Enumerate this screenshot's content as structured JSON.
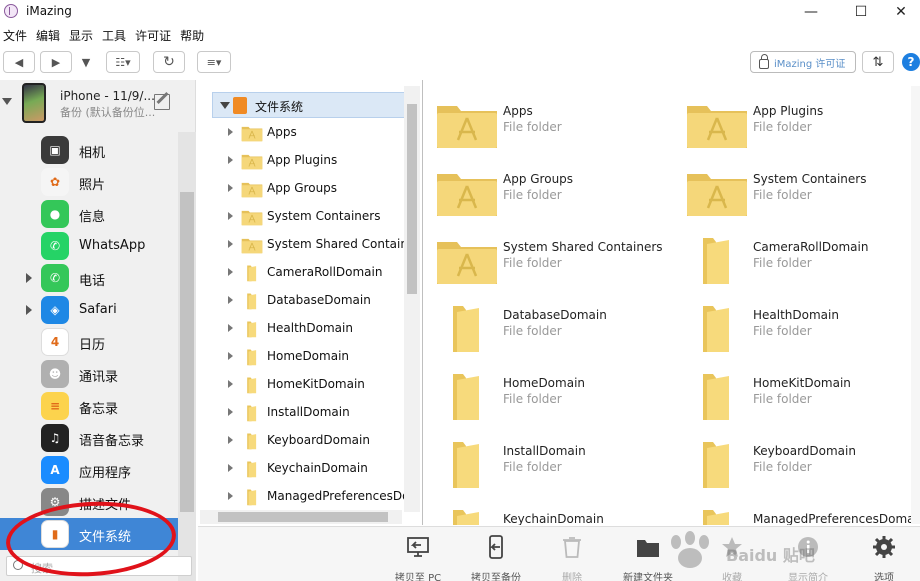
{
  "app": {
    "title": "iMazing"
  },
  "window_controls": {
    "minimize": "—",
    "maximize": "☐",
    "close": "✕"
  },
  "menu": [
    "文件",
    "编辑",
    "显示",
    "工具",
    "许可证",
    "帮助"
  ],
  "toolbar": {
    "back": "◀",
    "forward": "▶",
    "dropdown": "▼",
    "view": "☷▾",
    "refresh": "↻",
    "list": "≡▾",
    "license_label": "iMazing 许可证",
    "transfer": "⇅",
    "help": "?"
  },
  "device": {
    "name": "iPhone - 11/9/...",
    "subtitle": "备份 (默认备份位..."
  },
  "sidebar": {
    "items": [
      {
        "label": "相机",
        "icon": "camera-icon",
        "color": "#3a3a3a",
        "glyph": "▣",
        "expandable": false
      },
      {
        "label": "照片",
        "icon": "photos-icon",
        "color": "#f5f5f5",
        "glyph": "✿",
        "expandable": false
      },
      {
        "label": "信息",
        "icon": "messages-icon",
        "color": "#34c759",
        "glyph": "●",
        "expandable": false
      },
      {
        "label": "WhatsApp",
        "icon": "whatsapp-icon",
        "color": "#25d366",
        "glyph": "✆",
        "expandable": false
      },
      {
        "label": "电话",
        "icon": "phone-icon",
        "color": "#34c759",
        "glyph": "✆",
        "expandable": true
      },
      {
        "label": "Safari",
        "icon": "safari-icon",
        "color": "#1e88e5",
        "glyph": "◈",
        "expandable": true
      },
      {
        "label": "日历",
        "icon": "calendar-icon",
        "color": "#ffffff",
        "glyph": "4",
        "expandable": false
      },
      {
        "label": "通讯录",
        "icon": "contacts-icon",
        "color": "#b0b0b0",
        "glyph": "☻",
        "expandable": false
      },
      {
        "label": "备忘录",
        "icon": "notes-icon",
        "color": "#fcd34d",
        "glyph": "≡",
        "expandable": false
      },
      {
        "label": "语音备忘录",
        "icon": "voice-memos-icon",
        "color": "#222222",
        "glyph": "♫",
        "expandable": false
      },
      {
        "label": "应用程序",
        "icon": "app-store-icon",
        "color": "#1a8cff",
        "glyph": "A",
        "expandable": false
      },
      {
        "label": "描述文件",
        "icon": "profiles-icon",
        "color": "#888888",
        "glyph": "⚙",
        "expandable": false
      },
      {
        "label": "文件系统",
        "icon": "file-system-icon",
        "color": "#ffffff",
        "glyph": "▮",
        "expandable": false,
        "selected": true
      }
    ],
    "search_placeholder": "搜索"
  },
  "tree": {
    "root": "文件系统",
    "items": [
      {
        "label": "Apps",
        "kind": "app-folder"
      },
      {
        "label": "App Plugins",
        "kind": "app-folder"
      },
      {
        "label": "App Groups",
        "kind": "app-folder"
      },
      {
        "label": "System Containers",
        "kind": "app-folder"
      },
      {
        "label": "System Shared Containers",
        "kind": "app-folder"
      },
      {
        "label": "CameraRollDomain",
        "kind": "folder"
      },
      {
        "label": "DatabaseDomain",
        "kind": "folder"
      },
      {
        "label": "HealthDomain",
        "kind": "folder"
      },
      {
        "label": "HomeDomain",
        "kind": "folder"
      },
      {
        "label": "HomeKitDomain",
        "kind": "folder"
      },
      {
        "label": "InstallDomain",
        "kind": "folder"
      },
      {
        "label": "KeyboardDomain",
        "kind": "folder"
      },
      {
        "label": "KeychainDomain",
        "kind": "folder"
      },
      {
        "label": "ManagedPreferencesDom",
        "kind": "folder"
      }
    ]
  },
  "pane": {
    "type_label": "File folder",
    "items": [
      {
        "name": "Apps",
        "kind": "app-folder"
      },
      {
        "name": "App Plugins",
        "kind": "app-folder"
      },
      {
        "name": "App Groups",
        "kind": "app-folder"
      },
      {
        "name": "System Containers",
        "kind": "app-folder"
      },
      {
        "name": "System Shared Containers",
        "kind": "app-folder"
      },
      {
        "name": "CameraRollDomain",
        "kind": "folder"
      },
      {
        "name": "DatabaseDomain",
        "kind": "folder"
      },
      {
        "name": "HealthDomain",
        "kind": "folder"
      },
      {
        "name": "HomeDomain",
        "kind": "folder"
      },
      {
        "name": "HomeKitDomain",
        "kind": "folder"
      },
      {
        "name": "InstallDomain",
        "kind": "folder"
      },
      {
        "name": "KeyboardDomain",
        "kind": "folder"
      },
      {
        "name": "KeychainDomain",
        "kind": "folder"
      },
      {
        "name": "ManagedPreferencesDomain",
        "kind": "folder"
      }
    ]
  },
  "bottombar": {
    "buttons": [
      {
        "label": "拷贝至 PC",
        "icon": "copy-to-pc-icon",
        "enabled": true
      },
      {
        "label": "拷贝至备份",
        "icon": "copy-to-backup-icon",
        "enabled": true
      },
      {
        "label": "删除",
        "icon": "trash-icon",
        "enabled": false
      },
      {
        "label": "新建文件夹",
        "icon": "new-folder-icon",
        "enabled": true
      },
      {
        "label": "收藏",
        "icon": "star-icon",
        "enabled": false
      },
      {
        "label": "显示简介",
        "icon": "info-icon",
        "enabled": false
      },
      {
        "label": "选项",
        "icon": "gear-icon",
        "enabled": true
      }
    ]
  },
  "watermark": {
    "text": "Baidu 贴吧"
  },
  "colors": {
    "accent": "#3f86d6",
    "annotation": "#e0121a",
    "folder": "#f5d36b"
  }
}
